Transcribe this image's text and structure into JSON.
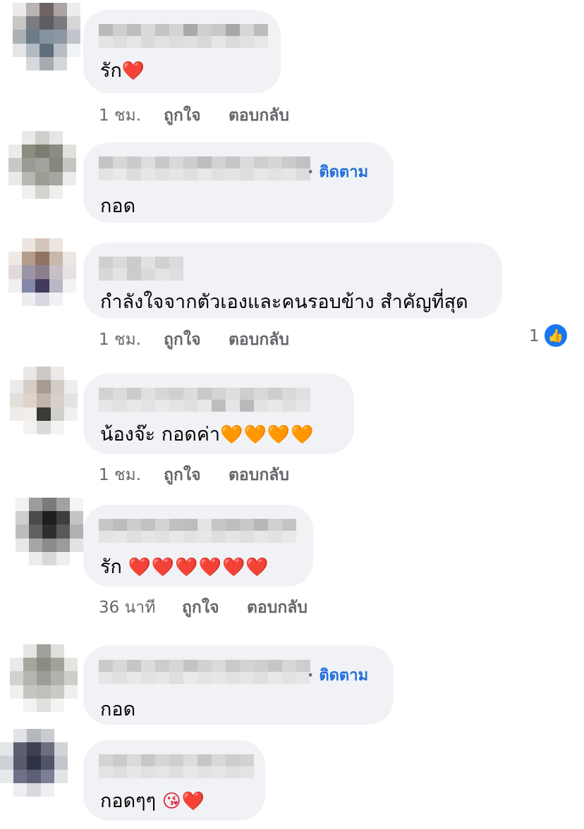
{
  "colors": {
    "bubble": "#f0f2f5",
    "link": "#216fdb",
    "meta": "#65676b",
    "like": "#1877f2"
  },
  "comments": [
    {
      "text": "รัก",
      "emoji": "❤️",
      "time": "1 ชม.",
      "like": "ถูกใจ",
      "reply": "ตอบกลับ"
    },
    {
      "follow": "ติดตาม",
      "text": "กอด"
    },
    {
      "text": "กำลังใจจากตัวเองและคนรอบข้าง สำคัญที่สุด",
      "time": "1 ชม.",
      "like": "ถูกใจ",
      "reply": "ตอบกลับ",
      "like_count": "1",
      "like_icon": "thumbs-up-icon"
    },
    {
      "text": "น้องจ๊ะ กอดค่า",
      "emoji": "🧡🧡🧡🧡",
      "time": "1 ชม.",
      "like": "ถูกใจ",
      "reply": "ตอบกลับ"
    },
    {
      "text": "รัก",
      "emoji": "❤️❤️❤️❤️❤️❤️",
      "time": "36 นาที",
      "like": "ถูกใจ",
      "reply": "ตอบกลับ"
    },
    {
      "follow": "ติดตาม",
      "text": "กอด"
    },
    {
      "text": "กอดๆๆ",
      "emoji": "😘❤️"
    }
  ]
}
